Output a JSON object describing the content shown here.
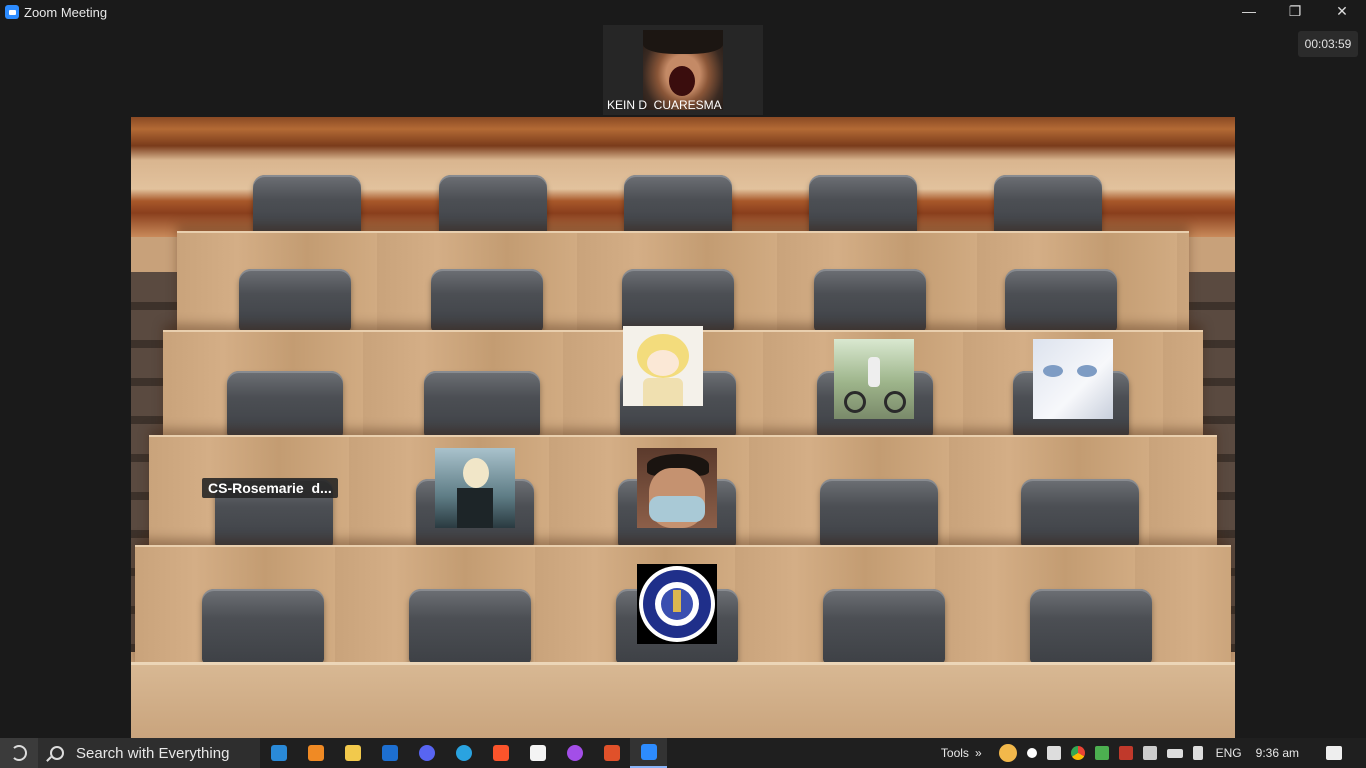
{
  "window": {
    "title": "Zoom Meeting"
  },
  "timer": "00:03:59",
  "active_speaker": {
    "name": "KEIN D  CUARESMA"
  },
  "participants": {
    "name_label": "CS-Rosemarie  d..."
  },
  "taskbar": {
    "search_label": "Search with Everything",
    "apps": [
      "vscode",
      "sublime-text",
      "file-explorer",
      "outlook",
      "discord",
      "telegram",
      "brave",
      "notion",
      "messenger",
      "brave-beta",
      "zoom"
    ],
    "tools_label": "Tools",
    "tools_chevron": "»",
    "language": "ENG",
    "time": "9:36 am"
  },
  "window_controls": {
    "minimize": "—",
    "restore": "❐",
    "close": "✕"
  },
  "colors": {
    "zoom_blue": "#2d8cff",
    "titlebar_bg": "#1a1a1a",
    "taskbar_bg": "#1f1f1f",
    "name_pill_bg": "#232323"
  }
}
